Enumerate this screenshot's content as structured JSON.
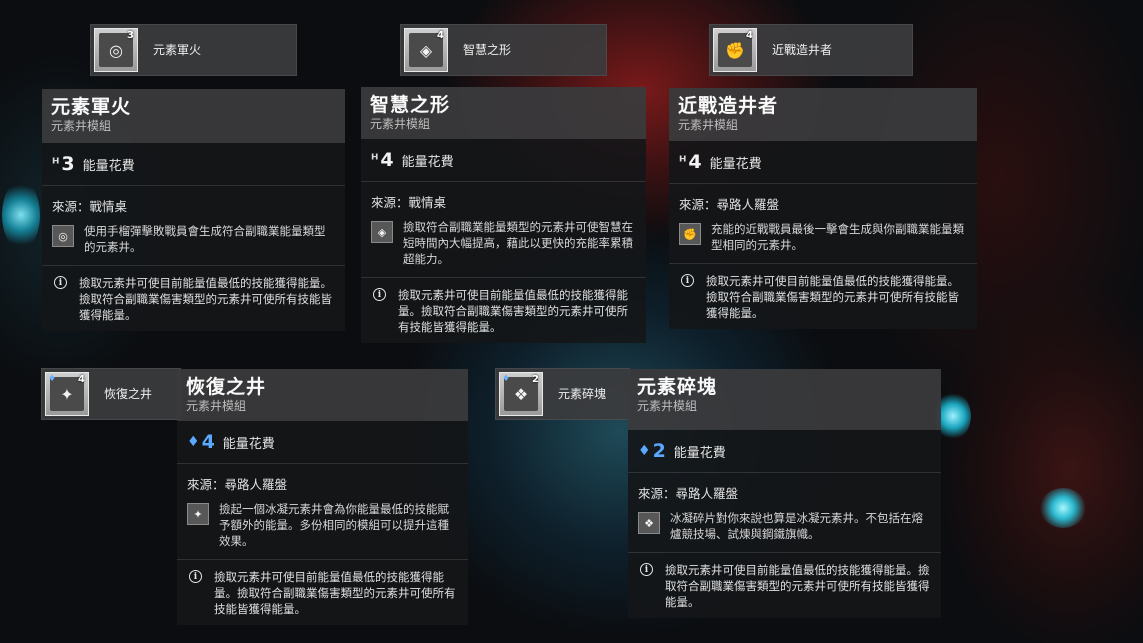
{
  "chips": [
    {
      "name": "元素軍火",
      "cost": "3",
      "icon": "grenade-icon",
      "glyph": "◎"
    },
    {
      "name": "智慧之形",
      "cost": "4",
      "icon": "diamond-icon",
      "glyph": "◈"
    },
    {
      "name": "近戰造井者",
      "cost": "4",
      "icon": "fist-icon",
      "glyph": "✊"
    },
    {
      "name": "恢復之井",
      "cost": "4",
      "icon": "well-icon",
      "glyph": "✦"
    },
    {
      "name": "元素碎塊",
      "cost": "2",
      "icon": "shard-icon",
      "glyph": "❖"
    }
  ],
  "cards": [
    {
      "title": "元素軍火",
      "subtitle": "元素井模組",
      "energy_symbol": "ᴴ",
      "energy": "3",
      "energy_label": "能量花費",
      "source": "來源：戰情桌",
      "perk_glyph": "◎",
      "perk_text": "使用手榴彈擊敗戰員會生成符合副職業能量類型的元素井。",
      "info_text": "撿取元素井可使目前能量值最低的技能獲得能量。撿取符合副職業傷害類型的元素井可使所有技能皆獲得能量。"
    },
    {
      "title": "智慧之形",
      "subtitle": "元素井模組",
      "energy_symbol": "ᴴ",
      "energy": "4",
      "energy_label": "能量花費",
      "source": "來源：戰情桌",
      "perk_glyph": "◈",
      "perk_text": "撿取符合副職業能量類型的元素井可使智慧在短時間內大幅提高，藉此以更快的充能率累積超能力。",
      "info_text": "撿取元素井可使目前能量值最低的技能獲得能量。撿取符合副職業傷害類型的元素井可使所有技能皆獲得能量。"
    },
    {
      "title": "近戰造井者",
      "subtitle": "元素井模組",
      "energy_symbol": "ᴴ",
      "energy": "4",
      "energy_label": "能量花費",
      "source": "來源：尋路人羅盤",
      "perk_glyph": "✊",
      "perk_text": "充能的近戰戰員最後一擊會生成與你副職業能量類型相同的元素井。",
      "info_text": "撿取元素井可使目前能量值最低的技能獲得能量。撿取符合副職業傷害類型的元素井可使所有技能皆獲得能量。"
    },
    {
      "title": "恢復之井",
      "subtitle": "元素井模組",
      "energy_symbol": "♦",
      "energy": "4",
      "energy_label": "能量花費",
      "source": "來源：尋路人羅盤",
      "perk_glyph": "✦",
      "perk_text": "撿起一個冰凝元素井會為你能量最低的技能賦予額外的能量。多份相同的模組可以提升這種效果。",
      "info_text": "撿取元素井可使目前能量值最低的技能獲得能量。撿取符合副職業傷害類型的元素井可使所有技能皆獲得能量。"
    },
    {
      "title": "元素碎塊",
      "subtitle": "元素井模組",
      "energy_symbol": "♦",
      "energy": "2",
      "energy_label": "能量花費",
      "source": "來源：尋路人羅盤",
      "perk_glyph": "❖",
      "perk_text": "冰凝碎片對你來說也算是冰凝元素井。不包括在熔爐競技場、試煉與鋼鐵旗幟。",
      "info_text": "撿取元素井可使目前能量值最低的技能獲得能量。撿取符合副職業傷害類型的元素井可使所有技能皆獲得能量。"
    }
  ],
  "info_glyph": "i",
  "colors": {
    "arc_blue": "#5aa9ff",
    "panel": "#3a3a3c",
    "body": "#141618"
  }
}
